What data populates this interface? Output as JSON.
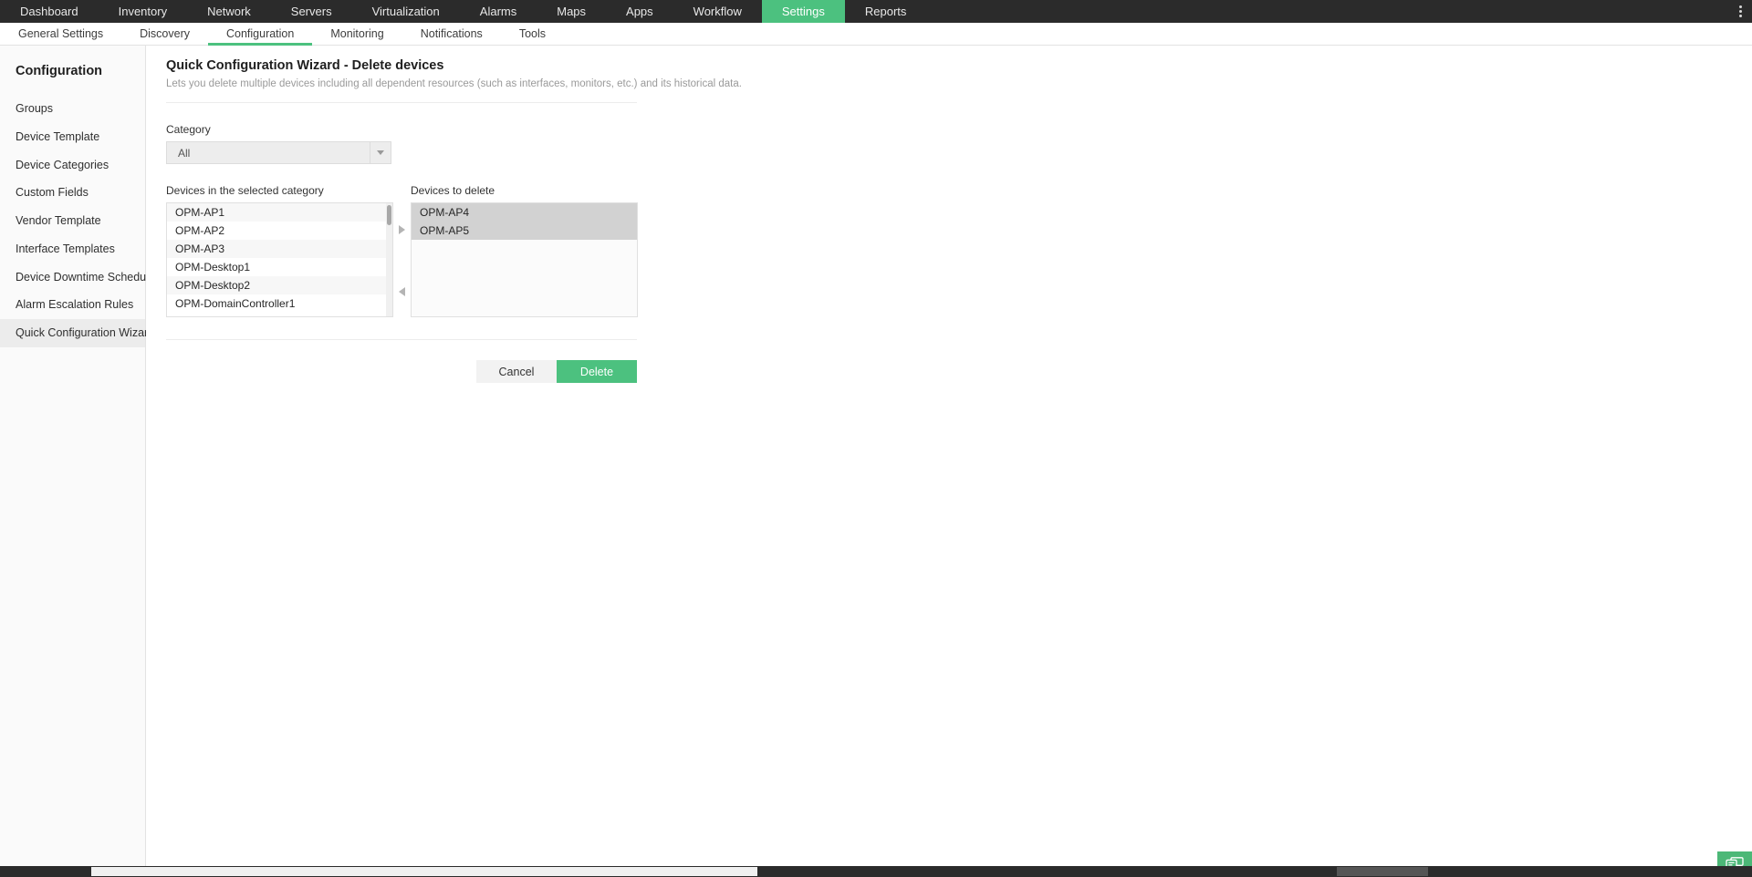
{
  "topnav": {
    "items": [
      {
        "label": "Dashboard",
        "active": false
      },
      {
        "label": "Inventory",
        "active": false
      },
      {
        "label": "Network",
        "active": false
      },
      {
        "label": "Servers",
        "active": false
      },
      {
        "label": "Virtualization",
        "active": false
      },
      {
        "label": "Alarms",
        "active": false
      },
      {
        "label": "Maps",
        "active": false
      },
      {
        "label": "Apps",
        "active": false
      },
      {
        "label": "Workflow",
        "active": false
      },
      {
        "label": "Settings",
        "active": true
      },
      {
        "label": "Reports",
        "active": false
      }
    ],
    "overflow_icon": "kebab-vertical-icon",
    "accent_color": "#4cc17f",
    "background_color": "#2b2b2b"
  },
  "subnav": {
    "items": [
      {
        "label": "General Settings",
        "active": false
      },
      {
        "label": "Discovery",
        "active": false
      },
      {
        "label": "Configuration",
        "active": true
      },
      {
        "label": "Monitoring",
        "active": false
      },
      {
        "label": "Notifications",
        "active": false
      },
      {
        "label": "Tools",
        "active": false
      }
    ]
  },
  "sidebar": {
    "title": "Configuration",
    "items": [
      {
        "label": "Groups",
        "active": false
      },
      {
        "label": "Device Template",
        "active": false
      },
      {
        "label": "Device Categories",
        "active": false
      },
      {
        "label": "Custom Fields",
        "active": false
      },
      {
        "label": "Vendor Template",
        "active": false
      },
      {
        "label": "Interface Templates",
        "active": false
      },
      {
        "label": "Device Downtime Schedules",
        "active": false
      },
      {
        "label": "Alarm Escalation Rules",
        "active": false
      },
      {
        "label": "Quick Configuration Wizard",
        "active": true
      }
    ]
  },
  "main": {
    "title": "Quick Configuration Wizard - Delete devices",
    "subtitle": "Lets you delete multiple devices including all dependent resources (such as interfaces, monitors, etc.) and its historical data.",
    "category": {
      "label": "Category",
      "selected": "All",
      "placeholder": "All",
      "caret_icon": "chevron-down-icon"
    },
    "source_list": {
      "label": "Devices in the selected category",
      "items": [
        "OPM-AP1",
        "OPM-AP2",
        "OPM-AP3",
        "OPM-Desktop1",
        "OPM-Desktop2",
        "OPM-DomainController1"
      ],
      "has_scrollbar": true
    },
    "target_list": {
      "label": "Devices to delete",
      "items": [
        "OPM-AP4",
        "OPM-AP5"
      ],
      "has_scrollbar": false
    },
    "transfer": {
      "move_right_icon": "triangle-right-icon",
      "move_left_icon": "triangle-left-icon"
    },
    "buttons": {
      "cancel": "Cancel",
      "delete": "Delete",
      "delete_color": "#4cc17f"
    }
  },
  "chat_widget": {
    "icon": "chat-bubbles-icon",
    "color": "#4cb877"
  }
}
